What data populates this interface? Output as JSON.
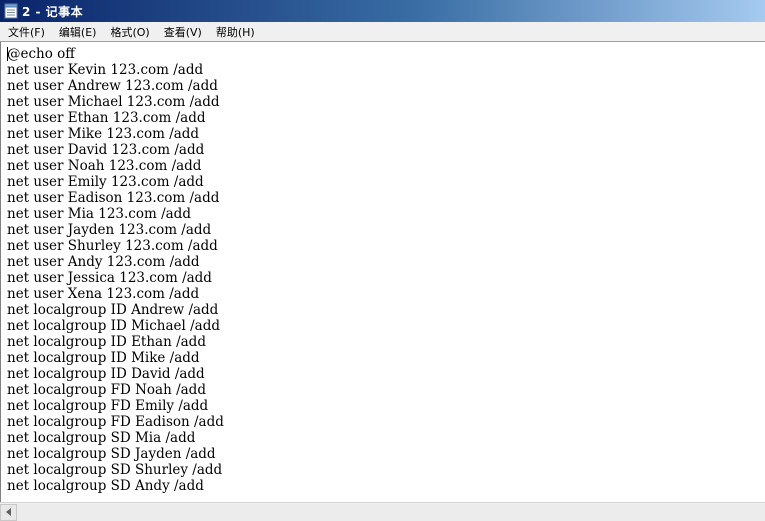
{
  "window": {
    "title": "2 - 记事本"
  },
  "menu": {
    "items": [
      {
        "label": "文件(F)"
      },
      {
        "label": "编辑(E)"
      },
      {
        "label": "格式(O)"
      },
      {
        "label": "查看(V)"
      },
      {
        "label": "帮助(H)"
      }
    ]
  },
  "document": {
    "lines": [
      "@echo off",
      "net user Kevin 123.com /add",
      "net user Andrew 123.com /add",
      "net user Michael 123.com /add",
      "net user Ethan 123.com /add",
      "net user Mike 123.com /add",
      "net user David 123.com /add",
      "net user Noah 123.com /add",
      "net user Emily 123.com /add",
      "net user Eadison 123.com /add",
      "net user Mia 123.com /add",
      "net user Jayden 123.com /add",
      "net user Shurley 123.com /add",
      "net user Andy 123.com /add",
      "net user Jessica 123.com /add",
      "net user Xena 123.com /add",
      "net localgroup ID Andrew /add",
      "net localgroup ID Michael /add",
      "net localgroup ID Ethan /add",
      "net localgroup ID Mike /add",
      "net localgroup ID David /add",
      "net localgroup FD Noah /add",
      "net localgroup FD Emily /add",
      "net localgroup FD Eadison /add",
      "net localgroup SD Mia /add",
      "net localgroup SD Jayden /add",
      "net localgroup SD Shurley /add",
      "net localgroup SD Andy /add"
    ]
  },
  "icons": {
    "app": "notepad-icon",
    "scroll_left": "arrow-left-icon"
  },
  "colors": {
    "titlebar_start": "#0a246a",
    "titlebar_end": "#a6caf0",
    "menubar_bg": "#f0f0f0"
  }
}
